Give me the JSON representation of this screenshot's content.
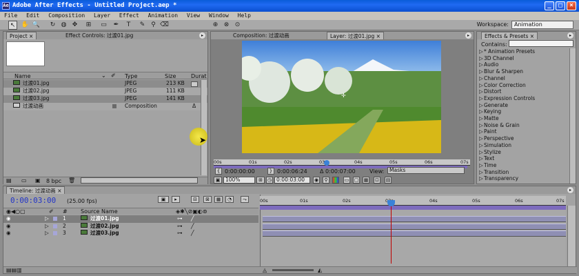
{
  "window": {
    "title": "Adobe After Effects - Untitled Project.aep *",
    "app_icon_glyph": "Ae"
  },
  "menu": [
    "File",
    "Edit",
    "Composition",
    "Layer",
    "Effect",
    "Animation",
    "View",
    "Window",
    "Help"
  ],
  "workspace": {
    "label": "Workspace:",
    "value": "Animation"
  },
  "project_panel": {
    "tab_project": "Project",
    "tab_effect_controls": "Effect Controls: 过渡01.jpg",
    "columns": [
      "Name",
      "Type",
      "Size",
      "Durat"
    ],
    "items": [
      {
        "name": "过渡01.jpg",
        "type": "JPEG",
        "size": "213 KB"
      },
      {
        "name": "过渡02.jpg",
        "type": "JPEG",
        "size": "111 KB"
      },
      {
        "name": "过渡03.jpg",
        "type": "JPEG",
        "size": "141 KB"
      },
      {
        "name": "过渡动画",
        "type": "Composition",
        "duration_mark": "Δ"
      }
    ],
    "bpc": "8 bpc"
  },
  "viewer": {
    "tab_composition": "Composition: 过渡动画",
    "tab_layer": "Layer: 过渡01.jpg",
    "ruler_ticks": [
      "00s",
      "01s",
      "02s",
      "03s",
      "04s",
      "05s",
      "06s",
      "07s"
    ],
    "in_point": "0:00:00:00",
    "out_point": "0:00:06:24",
    "duration": "Δ 0:00:07:00",
    "view_label": "View:",
    "view_value": "Masks",
    "zoom": "100%",
    "timecode": "0:00:03:00"
  },
  "effects_panel": {
    "title": "Effects & Presets",
    "contains_label": "Contains:",
    "items": [
      "* Animation Presets",
      "3D Channel",
      "Audio",
      "Blur & Sharpen",
      "Channel",
      "Color Correction",
      "Distort",
      "Expression Controls",
      "Generate",
      "Keying",
      "Matte",
      "Noise & Grain",
      "Paint",
      "Perspective",
      "Simulation",
      "Stylize",
      "Text",
      "Time",
      "Transition",
      "Transparency"
    ]
  },
  "timeline": {
    "tab": "Timeline: 过渡动画",
    "timecode": "0:00:03:00",
    "fps": "(25.00 fps)",
    "col_source": "Source Name",
    "col_num": "#",
    "ruler_ticks": [
      "00s",
      "01s",
      "02s",
      "03s",
      "04s",
      "05s",
      "06s",
      "07s"
    ],
    "layers": [
      {
        "num": "1",
        "name": "过渡01.jpg"
      },
      {
        "num": "2",
        "name": "过渡02.jpg"
      },
      {
        "num": "3",
        "name": "过渡03.jpg"
      }
    ]
  },
  "colors": {
    "titlebar": "#1f6af2",
    "panel": "#a3a3a3",
    "timecode": "#2234c8",
    "track": "#8f8fb4",
    "playhead": "#c00000",
    "label_swatch": "#a6a6d8"
  }
}
